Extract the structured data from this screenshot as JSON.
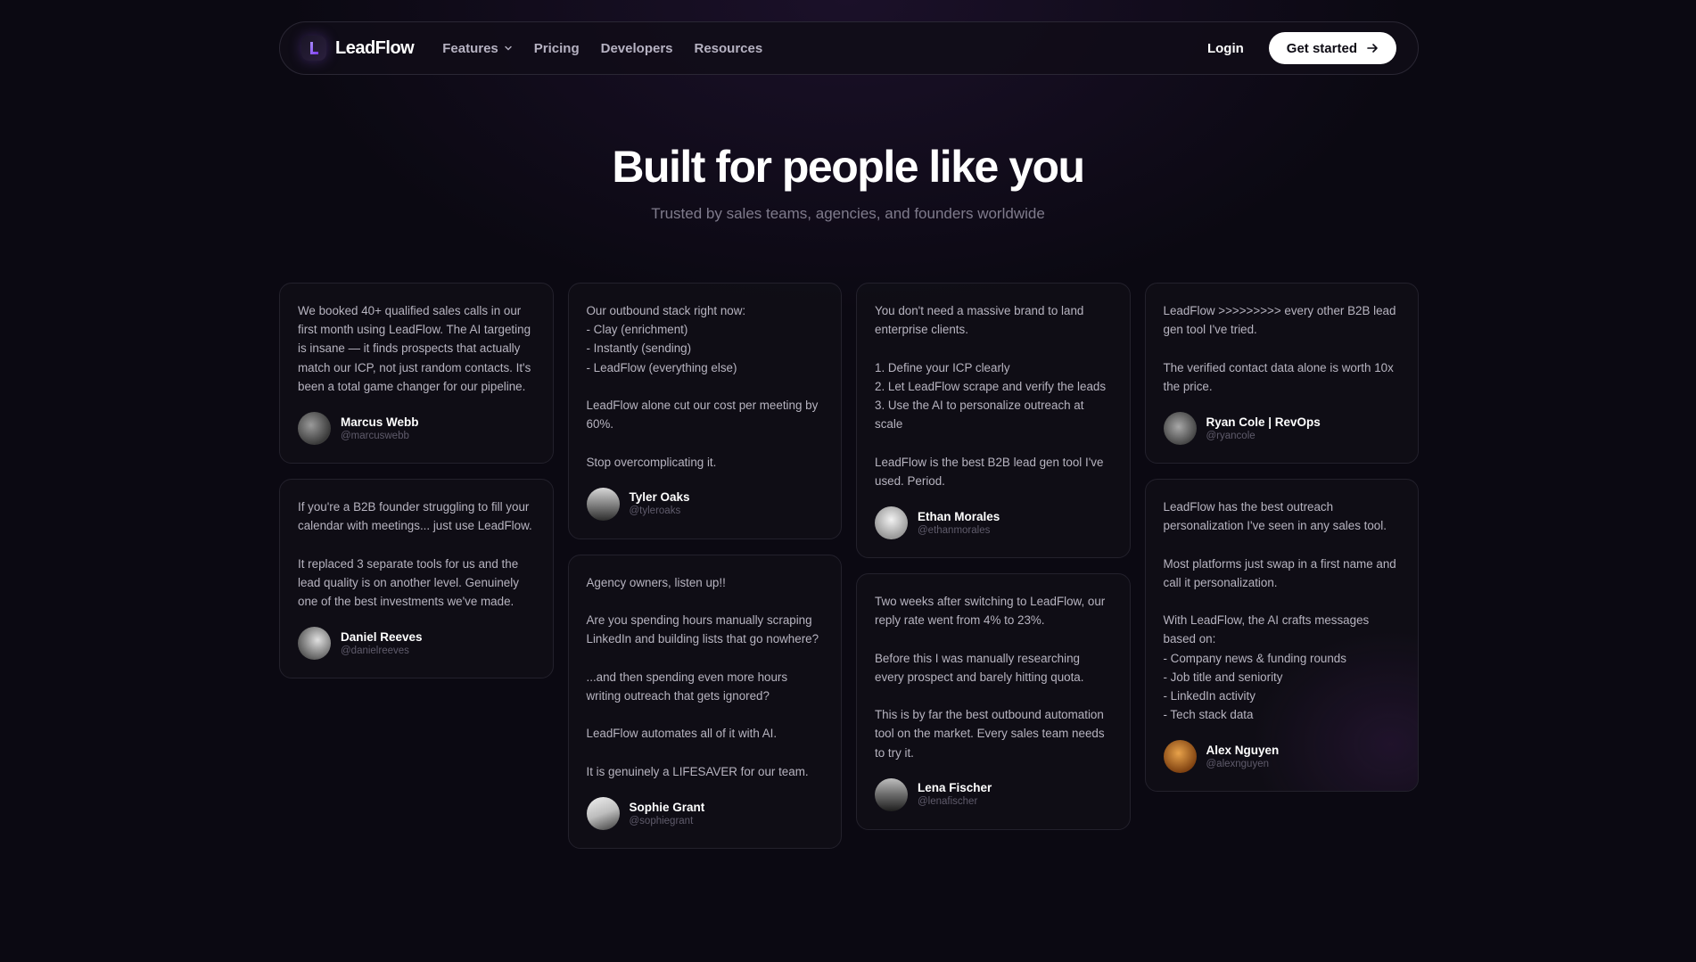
{
  "nav": {
    "brand": "LeadFlow",
    "links": [
      "Features",
      "Pricing",
      "Developers",
      "Resources"
    ],
    "login": "Login",
    "cta": "Get started"
  },
  "hero": {
    "title": "Built for people like you",
    "subtitle": "Trusted by sales teams, agencies, and founders worldwide"
  },
  "testimonials": [
    {
      "text": "We booked 40+ qualified sales calls in our first month using LeadFlow. The AI targeting is insane — it finds prospects that actually match our ICP, not just random contacts. It's been a total game changer for our pipeline.",
      "name": "Marcus Webb",
      "handle": "@marcuswebb"
    },
    {
      "text": "If you're a B2B founder struggling to fill your calendar with meetings... just use LeadFlow.\n\nIt replaced 3 separate tools for us and the lead quality is on another level. Genuinely one of the best investments we've made.",
      "name": "Daniel Reeves",
      "handle": "@danielreeves"
    },
    {
      "text": "Our outbound stack right now:\n- Clay (enrichment)\n- Instantly (sending)\n- LeadFlow (everything else)\n\nLeadFlow alone cut our cost per meeting by 60%.\n\nStop overcomplicating it.",
      "name": "Tyler Oaks",
      "handle": "@tyleroaks"
    },
    {
      "text": "Agency owners, listen up!!\n\nAre you spending hours manually scraping LinkedIn and building lists that go nowhere?\n\n...and then spending even more hours writing outreach that gets ignored?\n\nLeadFlow automates all of it with AI.\n\nIt is genuinely a LIFESAVER for our team.",
      "name": "Sophie Grant",
      "handle": "@sophiegrant"
    },
    {
      "text": "You don't need a massive brand to land enterprise clients.\n\n1. Define your ICP clearly\n2. Let LeadFlow scrape and verify the leads\n3. Use the AI to personalize outreach at scale\n\nLeadFlow is the best B2B lead gen tool I've used. Period.",
      "name": "Ethan Morales",
      "handle": "@ethanmorales"
    },
    {
      "text": "Two weeks after switching to LeadFlow, our reply rate went from 4% to 23%.\n\nBefore this I was manually researching every prospect and barely hitting quota.\n\nThis is by far the best outbound automation tool on the market. Every sales team needs to try it.",
      "name": "Lena Fischer",
      "handle": "@lenafischer"
    },
    {
      "text": "LeadFlow >>>>>>>>> every other B2B lead gen tool I've tried.\n\nThe verified contact data alone is worth 10x the price.",
      "name": "Ryan Cole | RevOps",
      "handle": "@ryancole"
    },
    {
      "text": "LeadFlow has the best outreach personalization I've seen in any sales tool.\n\nMost platforms just swap in a first name and call it personalization.\n\nWith LeadFlow, the AI crafts messages based on:\n- Company news & funding rounds\n- Job title and seniority\n- LinkedIn activity\n- Tech stack data",
      "name": "Alex Nguyen",
      "handle": "@alexnguyen"
    }
  ],
  "colors": {
    "background": "#0b0912",
    "accent": "#8b5cf6",
    "card_border": "#23212c",
    "cta_bg": "#ffffff"
  }
}
